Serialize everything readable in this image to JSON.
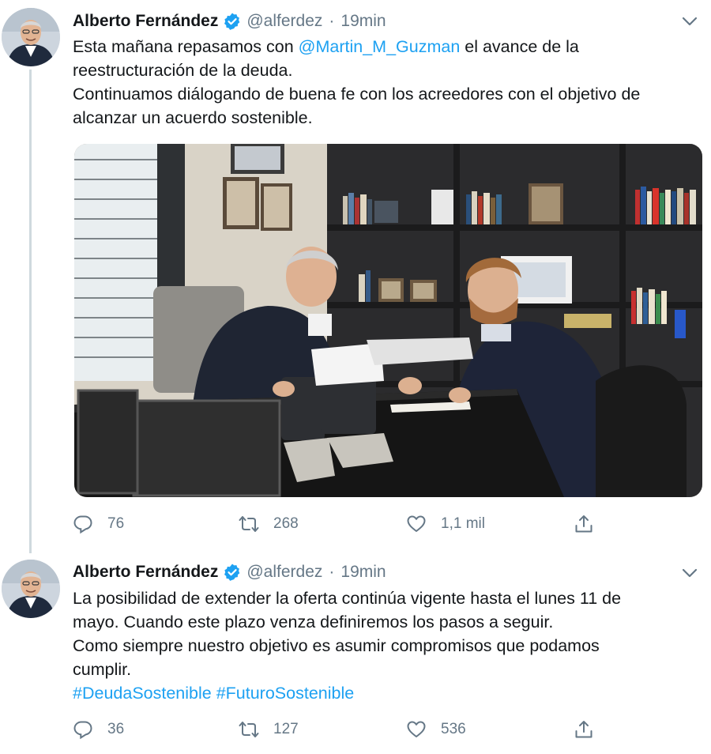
{
  "tweets": [
    {
      "author_name": "Alberto Fernández",
      "handle": "@alferdez",
      "separator": "·",
      "time": "19min",
      "text": {
        "l1_pre": "Esta mañana repasamos con ",
        "l1_mention": "@Martin_M_Guzman",
        "l1_post": " el avance de la",
        "l2": "reestructuración de la deuda.",
        "l3": "Continuamos diálogando de buena fe con los acreedores con el objetivo de",
        "l4": "alcanzar un acuerdo sostenible."
      },
      "replies": "76",
      "retweets": "268",
      "likes": "1,1 mil"
    },
    {
      "author_name": "Alberto Fernández",
      "handle": "@alferdez",
      "separator": "·",
      "time": "19min",
      "text": {
        "l1": "La posibilidad de extender la oferta continúa vigente hasta el lunes 11 de",
        "l2": "mayo. Cuando este plazo venza definiremos los pasos a seguir.",
        "l3": "Como siempre nuestro objetivo es asumir compromisos que podamos",
        "l4": "cumplir.",
        "hashtag1": "#DeudaSostenible",
        "hashtag2": "#FuturoSostenible"
      },
      "replies": "36",
      "retweets": "127",
      "likes": "536"
    }
  ],
  "colors": {
    "link": "#1da1f2",
    "text": "#14171a",
    "muted": "#657786",
    "thread_line": "#cfd9de"
  },
  "icons": [
    "verified-badge-icon",
    "chevron-down-icon",
    "reply-icon",
    "retweet-icon",
    "like-icon",
    "share-icon"
  ]
}
